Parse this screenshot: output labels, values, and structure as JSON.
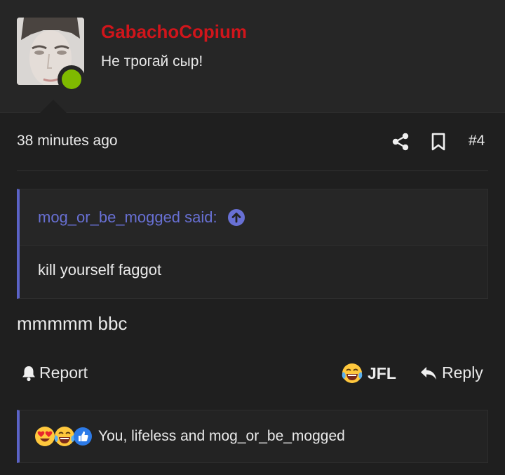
{
  "user": {
    "name": "GabachoCopium",
    "title": "Не трогай сыр!",
    "status": "online",
    "status_color": "#7fba00",
    "name_color": "#d0151b"
  },
  "post": {
    "time": "38 minutes ago",
    "number": "#4",
    "quote_author": "mog_or_be_mogged said:",
    "quote_text": "kill yourself faggot",
    "body": "mmmmm bbc"
  },
  "actions": {
    "report_label": "Report",
    "jfl_label": "JFL",
    "reply_label": "Reply"
  },
  "reactions": {
    "icons": [
      "heart-eyes-emoji",
      "laughing-crying-emoji",
      "thumbs-up-icon"
    ],
    "text": "You, lifeless and mog_or_be_mogged"
  },
  "colors": {
    "accent": "#5b63c7",
    "link": "#6870d4",
    "background": "#1f1f1f"
  }
}
